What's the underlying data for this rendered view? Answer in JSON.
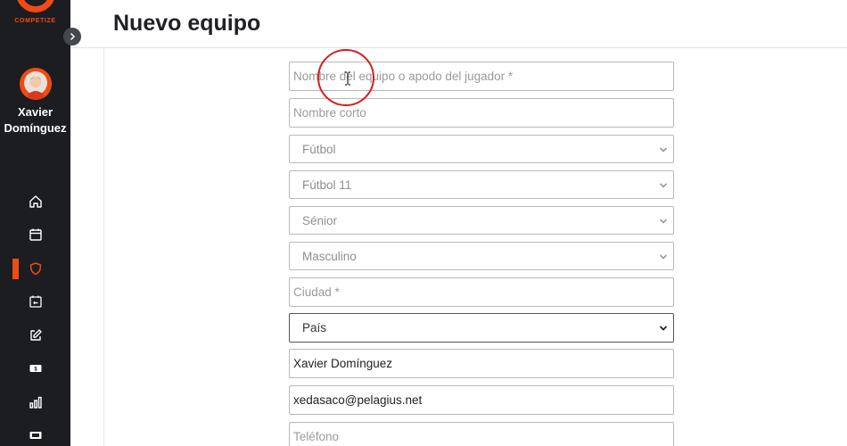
{
  "brand": {
    "logo_text": "COMPETIZE",
    "accent": "#f04a15"
  },
  "user": {
    "name_first": "Xavier",
    "name_last": "Domínguez"
  },
  "sidebar": {
    "items": [
      {
        "icon": "home-icon"
      },
      {
        "icon": "calendar-icon"
      },
      {
        "icon": "shield-icon",
        "active": true
      },
      {
        "icon": "calendar-score-icon"
      },
      {
        "icon": "edit-icon"
      },
      {
        "icon": "money-icon"
      },
      {
        "icon": "stats-icon"
      },
      {
        "icon": "ticket-icon"
      }
    ]
  },
  "header": {
    "title": "Nuevo equipo"
  },
  "form": {
    "team_name": {
      "placeholder": "Nombre del equipo o apodo del jugador *",
      "value": ""
    },
    "short_name": {
      "placeholder": "Nombre corto",
      "value": ""
    },
    "sport": {
      "selected": "Fútbol"
    },
    "modality": {
      "selected": "Fútbol 11"
    },
    "category": {
      "selected": "Sénior"
    },
    "gender": {
      "selected": "Masculino"
    },
    "city": {
      "placeholder": "Ciudad *",
      "value": ""
    },
    "country": {
      "selected": "País"
    },
    "contact_name": {
      "value": "Xavier Domínguez"
    },
    "email": {
      "value": "xedasaco@pelagius.net"
    },
    "phone": {
      "placeholder": "Teléfono",
      "value": ""
    }
  }
}
